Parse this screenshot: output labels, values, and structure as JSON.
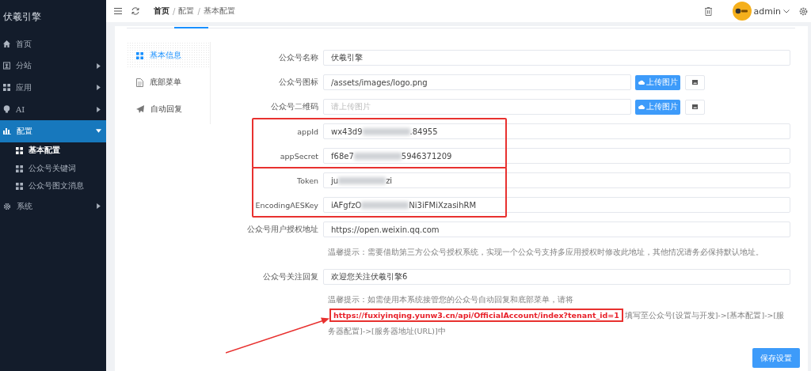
{
  "sidebar": {
    "brand": "伏羲引擎",
    "items": [
      {
        "label": "首页",
        "selected": false
      },
      {
        "label": "分站",
        "expanded": false,
        "selected": false
      },
      {
        "label": "应用",
        "expanded": false,
        "selected": false
      },
      {
        "label": "AI",
        "expanded": false,
        "selected": false
      },
      {
        "label": "配置",
        "expanded": true,
        "selected": true,
        "children": [
          {
            "label": "基本配置",
            "selected": true
          },
          {
            "label": "公众号关键词",
            "selected": false
          },
          {
            "label": "公众号图文消息",
            "selected": false
          }
        ]
      },
      {
        "label": "系统",
        "expanded": false,
        "selected": false
      }
    ]
  },
  "header": {
    "breadcrumb": [
      {
        "label": "首页"
      },
      {
        "separator": "/",
        "label": "配置"
      },
      {
        "separator": "/",
        "label": "基本配置"
      }
    ],
    "user": "admin"
  },
  "tabs": [
    {
      "label": "基本信息",
      "selected": true
    },
    {
      "label": "底部菜单",
      "selected": false
    },
    {
      "label": "自动回复",
      "selected": false
    }
  ],
  "form": {
    "groups": [
      {
        "kind": "plain",
        "rows": [
          {
            "kind": "text",
            "label": "公众号名称",
            "value": "伏羲引擎"
          },
          {
            "kind": "upload",
            "label": "公众号图标",
            "value": "/assets/images/logo.png",
            "button": "上传图片"
          },
          {
            "kind": "upload",
            "label": "公众号二维码",
            "placeholder": "请上传图片",
            "button": "上传图片"
          }
        ]
      },
      {
        "kind": "highlighted",
        "rows": [
          {
            "kind": "text",
            "label": "appId",
            "value": "wx43d9",
            "value_end": ".84955",
            "redacted": true
          },
          {
            "kind": "text",
            "label": "appSecret",
            "value": "f68e7",
            "value_end": "5946371209",
            "redacted": true
          }
        ]
      },
      {
        "kind": "highlighted",
        "rows": [
          {
            "kind": "text",
            "label": "Token",
            "value": "ju",
            "value_end": "zi",
            "redacted": true
          },
          {
            "kind": "text",
            "label": "EncodingAESKey",
            "value": "iAFgfzO",
            "value_end": "Ni3iFMiXzasihRM",
            "redacted": true
          }
        ]
      },
      {
        "kind": "plain",
        "rows": [
          {
            "kind": "text",
            "label": "公众号用户授权地址",
            "value": "https://open.weixin.qq.com"
          },
          {
            "kind": "hint",
            "text": "温馨提示：需要借助第三方公众号授权系统，实现一个公众号支持多应用授权时修改此地址，其他情况请务必保持默认地址。"
          },
          {
            "kind": "text",
            "label": "公众号关注回复",
            "value": "欢迎您关注伏羲引擎6"
          },
          {
            "kind": "marked_hint",
            "text": "温馨提示：如需使用本系统接管您的公众号自动回复和底部菜单，请将**https://fuxiyinqing.yunw3.cn/api/OfficialAccount/index?tenant_id=1**填写至公众号[设置与开发]->[基本配置]->[服务器配置]->[服务器地址(URL)]中"
          }
        ]
      }
    ],
    "annotation_arrow": true,
    "save_button": "保存设置"
  }
}
